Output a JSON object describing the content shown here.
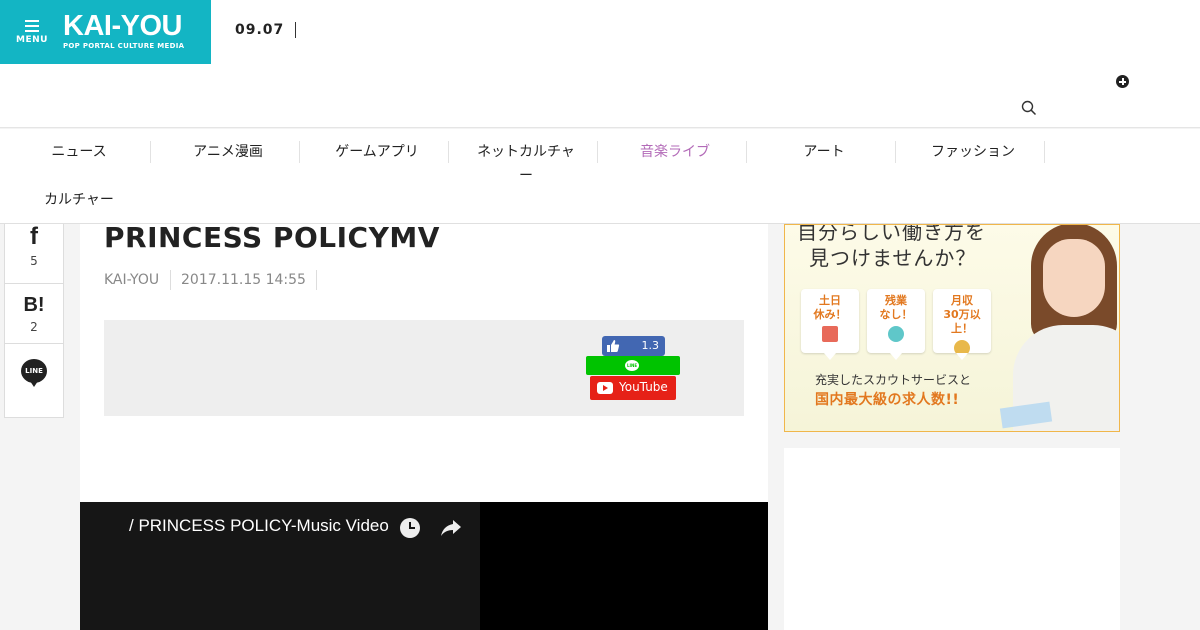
{
  "header": {
    "menu_label": "MENU",
    "logo_text": "KAI-YOU",
    "logo_subtitle": "POP PORTAL CULTURE MEDIA",
    "date": "09.07",
    "brand_color": "#13b5c4"
  },
  "nav": {
    "items": [
      {
        "label": "ニュース"
      },
      {
        "label": "アニメ漫画"
      },
      {
        "label": "ゲームアプリ"
      },
      {
        "label": "ネットカルチャー"
      },
      {
        "label": "音楽ライブ",
        "active": true
      },
      {
        "label": "アート"
      },
      {
        "label": "ファッション"
      },
      {
        "label": "カルチャー"
      }
    ],
    "active_color": "#b36bb8"
  },
  "share": {
    "facebook_glyph": "f",
    "facebook_count": "5",
    "hatena_glyph": "B!",
    "hatena_count": "2",
    "line_label": "LINE"
  },
  "article": {
    "title": "PRINCESS POLICYMV",
    "author": "KAI-YOU",
    "timestamp": "2017.11.15 14:55",
    "fb_like_count": "1.3",
    "line_bubble": "LINE",
    "youtube_label": "YouTube",
    "video_title": "/ PRINCESS POLICY-Music Video"
  },
  "ad": {
    "headline_1": "自分らしい働き方を",
    "headline_2": "見つけませんか？",
    "cards": [
      {
        "text": "土日\n休み！"
      },
      {
        "text": "残業\nなし！"
      },
      {
        "text": "月収\n30万以上！"
      }
    ],
    "subtext": "充実したスカウトサービスと",
    "maintext": "国内最大級の求人数!!",
    "accent_color": "#e2781f"
  }
}
